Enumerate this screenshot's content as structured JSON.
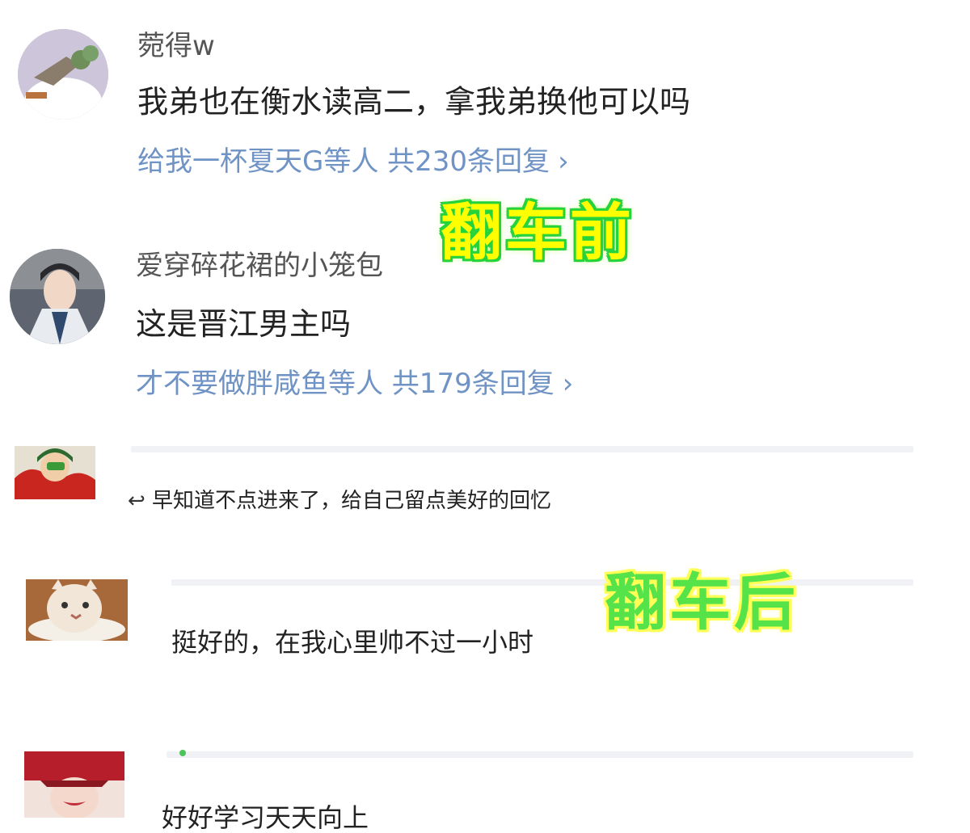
{
  "comments_before": [
    {
      "username": "菀得w",
      "text": "我弟也在衡水读高二，拿我弟换他可以吗",
      "replies_text": "给我一杯夏天G等人 共230条回复",
      "avatar_icon": "cartoon-animal-avatar-icon"
    },
    {
      "username": "爱穿碎花裙的小笼包",
      "text": "这是晋江男主吗",
      "replies_text": "才不要做胖咸鱼等人 共179条回复",
      "avatar_icon": "costume-actor-avatar-icon"
    }
  ],
  "label_before": "翻车前",
  "label_after": "翻车后",
  "comments_after": [
    {
      "text": "早知道不点进来了，给自己留点美好的回忆",
      "avatar_icon": "costume-character-avatar-icon"
    },
    {
      "text": "挺好的，在我心里帅不过一小时",
      "avatar_icon": "cat-avatar-icon"
    },
    {
      "text": "好好学习天天向上",
      "avatar_icon": "red-mask-avatar-icon"
    }
  ],
  "colors": {
    "reply_link": "#6f93c4",
    "label_yellow": "#ffff00",
    "label_green": "#27d33a"
  }
}
